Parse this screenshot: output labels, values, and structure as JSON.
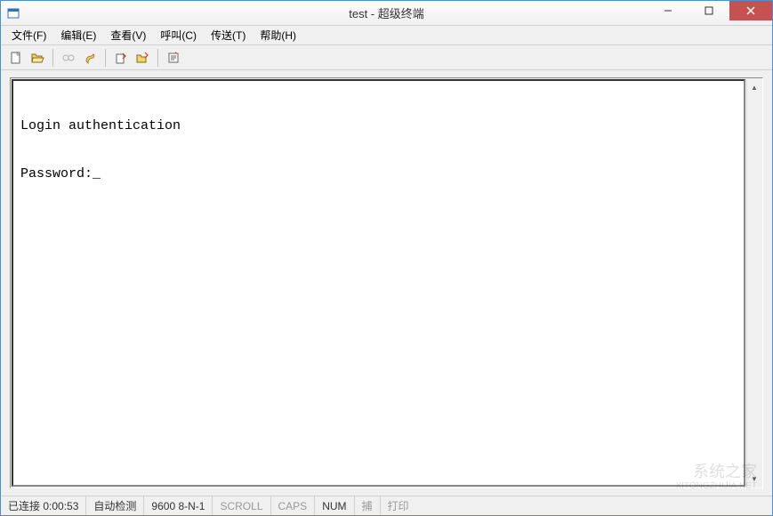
{
  "window": {
    "title": "test - 超级终端"
  },
  "menu": {
    "file": "文件(F)",
    "edit": "编辑(E)",
    "view": "查看(V)",
    "call": "呼叫(C)",
    "transfer": "传送(T)",
    "help": "帮助(H)"
  },
  "toolbar": {
    "icons": {
      "new": "new-file-icon",
      "open": "open-folder-icon",
      "connect": "connect-icon",
      "disconnect": "phone-icon",
      "send": "send-icon",
      "receive": "receive-icon",
      "properties": "properties-icon"
    }
  },
  "terminal": {
    "line1": "Login authentication",
    "line2_prompt": "Password:",
    "cursor": "_"
  },
  "status": {
    "connected_prefix": "已连接",
    "time": "0:00:53",
    "auto_detect": "自动检测",
    "port_settings": "9600 8-N-1",
    "scroll": "SCROLL",
    "caps": "CAPS",
    "num": "NUM",
    "capture": "捕",
    "print": "打印"
  },
  "watermark": {
    "line1": "系统之家",
    "line2": "XITONGZHIJIA.NET"
  }
}
